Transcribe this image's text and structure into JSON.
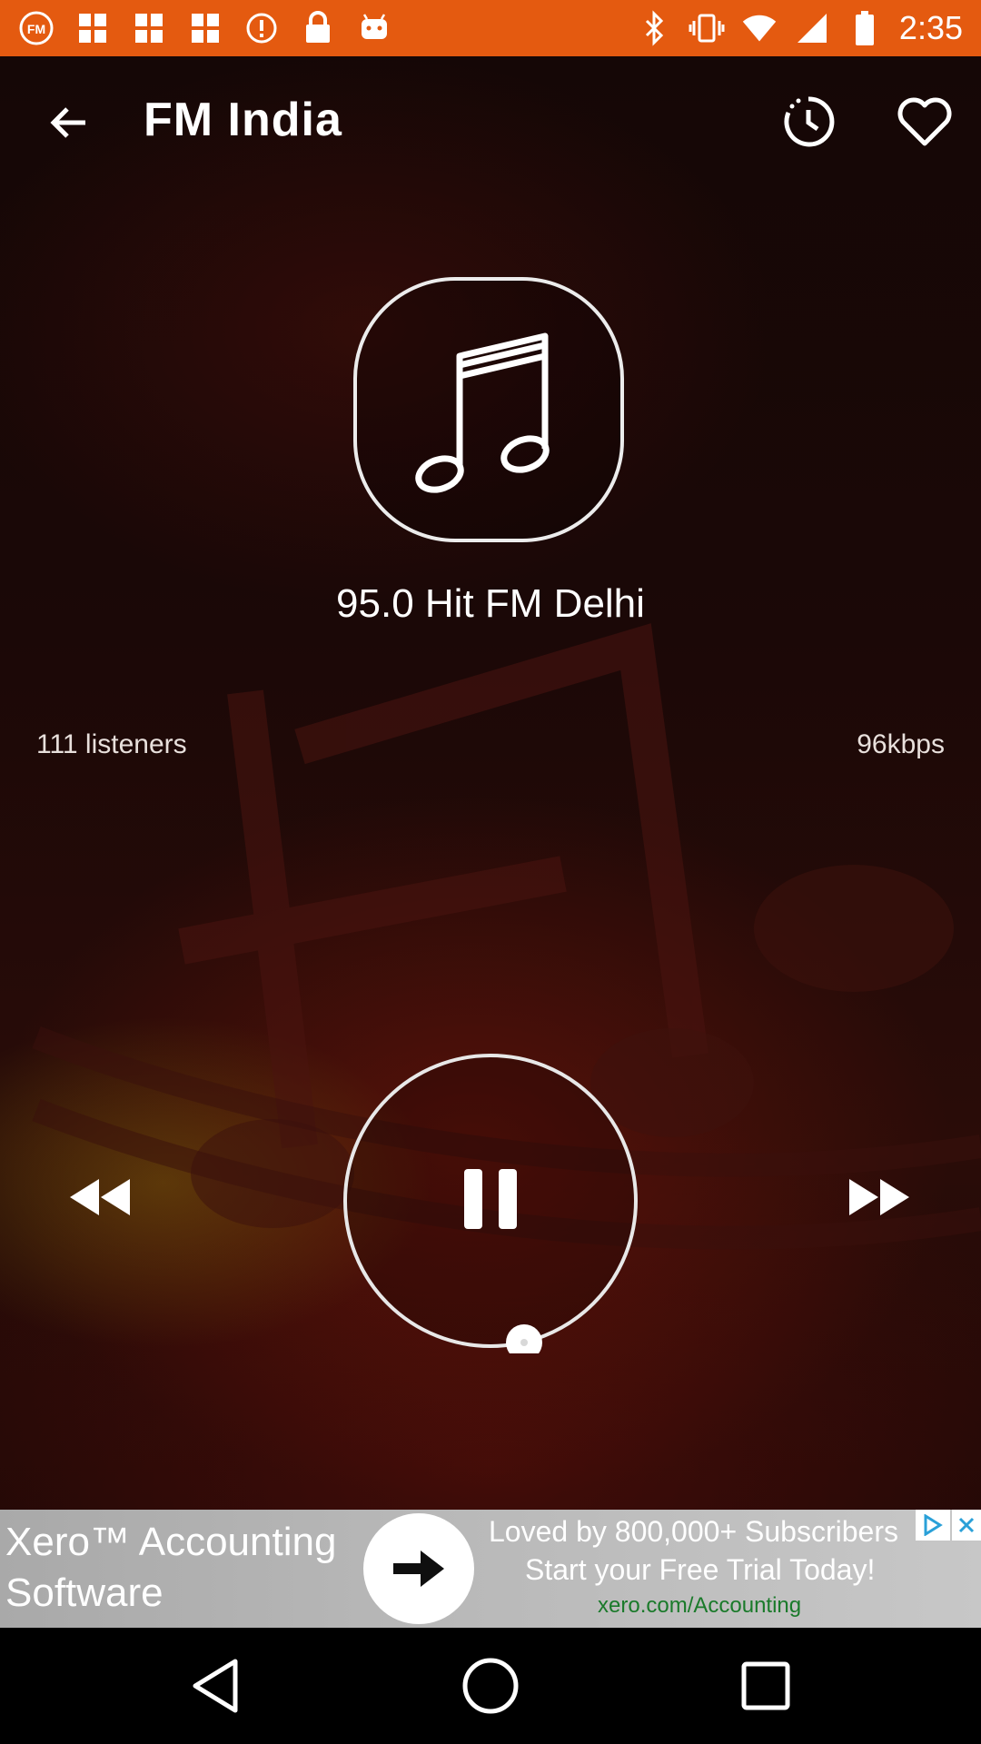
{
  "status_bar": {
    "time": "2:35",
    "bg_color": "#e45a10",
    "left_icons": [
      "fm-app-icon",
      "grid-icon",
      "grid-icon",
      "grid-icon",
      "alert-icon",
      "lock-icon",
      "android-icon"
    ],
    "right_icons": [
      "bluetooth-icon",
      "vibrate-icon",
      "wifi-icon",
      "signal-icon",
      "battery-icon"
    ]
  },
  "app_bar": {
    "title": "FM India",
    "back_icon": "arrow-back-icon",
    "timer_icon": "sleep-timer-icon",
    "favorite_icon": "heart-outline-icon"
  },
  "station": {
    "name": "95.0 Hit FM Delhi",
    "listeners": "111 listeners",
    "bitrate": "96kbps",
    "artwork_icon": "music-note-icon"
  },
  "player": {
    "state": "playing",
    "rewind_icon": "rewind-icon",
    "pause_icon": "pause-icon",
    "forward_icon": "fast-forward-icon"
  },
  "ad": {
    "title": "Xero™ Accounting Software",
    "line1": "Loved by 800,000+ Subscribers",
    "line2": "Start your Free Trial Today!",
    "url": "xero.com/Accounting",
    "url_color": "#1a7a2a"
  },
  "nav_bar": {
    "back_icon": "nav-back-icon",
    "home_icon": "nav-home-icon",
    "recents_icon": "nav-recents-icon"
  }
}
